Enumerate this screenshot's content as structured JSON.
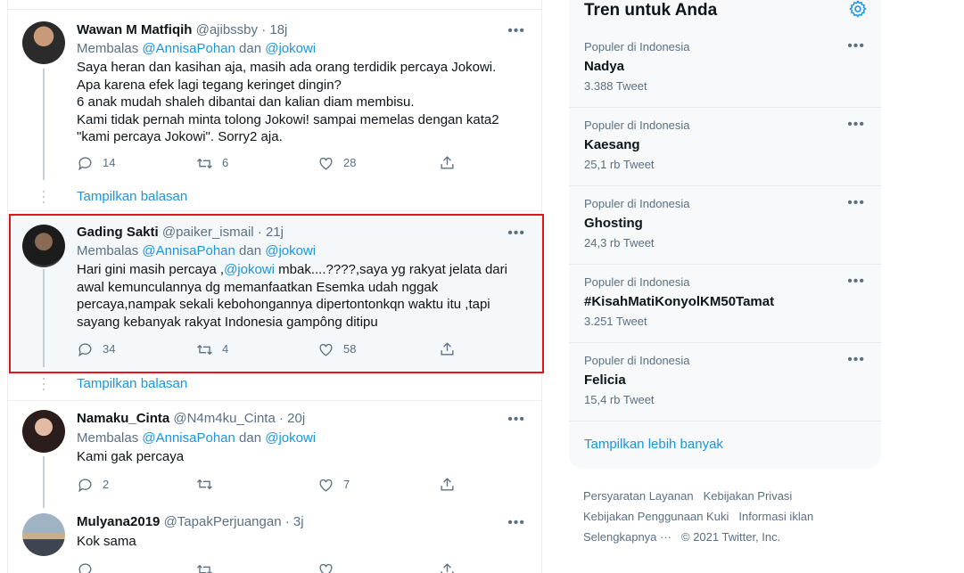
{
  "feed": {
    "show_replies_label": "Tampilkan balasan",
    "reply_prefix": "Membalas",
    "reply_conj": "dan",
    "tweets": [
      {
        "name": "Wawan M Matfiqih",
        "handle": "@ajibssby · 18j",
        "reply_users": [
          "@AnnisaPohan",
          "@jokowi"
        ],
        "lines": [
          "Saya heran dan kasihan aja, masih ada orang terdidik percaya Jokowi.",
          "Apa karena efek lagi tegang keringet dingin?",
          "6 anak mudah shaleh dibantai dan kalian diam membisu.",
          "Kami tidak pernah minta tolong Jokowi! sampai memelas dengan kata2",
          "\"kami percaya Jokowi\". Sorry2 aja."
        ],
        "replies": "14",
        "retweets": "6",
        "likes": "28"
      },
      {
        "name": "Gading Sakti",
        "handle": "@paiker_ismail · 21j",
        "reply_users": [
          "@AnnisaPohan",
          "@jokowi"
        ],
        "text_pre": "Hari gini masih percaya ,",
        "text_mention": "@jokowi",
        "text_post": "  mbak....????,saya yg rakyat jelata dari awal kemunculannya dg memanfaatkan Esemka udah nggak percaya,nampak sekali kebohongannya dipertontonkqn waktu itu ,tapi sayang kebanyak rakyat Indonesia gampông ditipu",
        "replies": "34",
        "retweets": "4",
        "likes": "58"
      },
      {
        "name": "Namaku_Cinta",
        "handle": "@N4m4ku_Cinta · 20j",
        "reply_users": [
          "@AnnisaPohan",
          "@jokowi"
        ],
        "text": "Kami gak percaya",
        "replies": "2",
        "retweets": "",
        "likes": "7"
      },
      {
        "name": "Mulyana2019",
        "handle": "@TapakPerjuangan · 3j",
        "text": "Kok sama"
      }
    ]
  },
  "sidebar": {
    "title": "Tren untuk Anda",
    "trends": [
      {
        "meta": "Populer di Indonesia",
        "name": "Nadya",
        "count": "3.388 Tweet"
      },
      {
        "meta": "Populer di Indonesia",
        "name": "Kaesang",
        "count": "25,1 rb Tweet"
      },
      {
        "meta": "Populer di Indonesia",
        "name": "Ghosting",
        "count": "24,3 rb Tweet"
      },
      {
        "meta": "Populer di Indonesia",
        "name": "#KisahMatiKonyolKM50Tamat",
        "count": "3.251 Tweet"
      },
      {
        "meta": "Populer di Indonesia",
        "name": "Felicia",
        "count": "15,4 rb Tweet"
      }
    ],
    "show_more": "Tampilkan lebih banyak"
  },
  "footer": {
    "links": [
      "Persyaratan Layanan",
      "Kebijakan Privasi",
      "Kebijakan Penggunaan Kuki",
      "Informasi iklan",
      "Selengkapnya ···",
      "© 2021 Twitter, Inc."
    ]
  },
  "colors": {
    "accent": "#1b95e0",
    "highlight_border": "#e0161b",
    "muted": "#5b7083"
  }
}
